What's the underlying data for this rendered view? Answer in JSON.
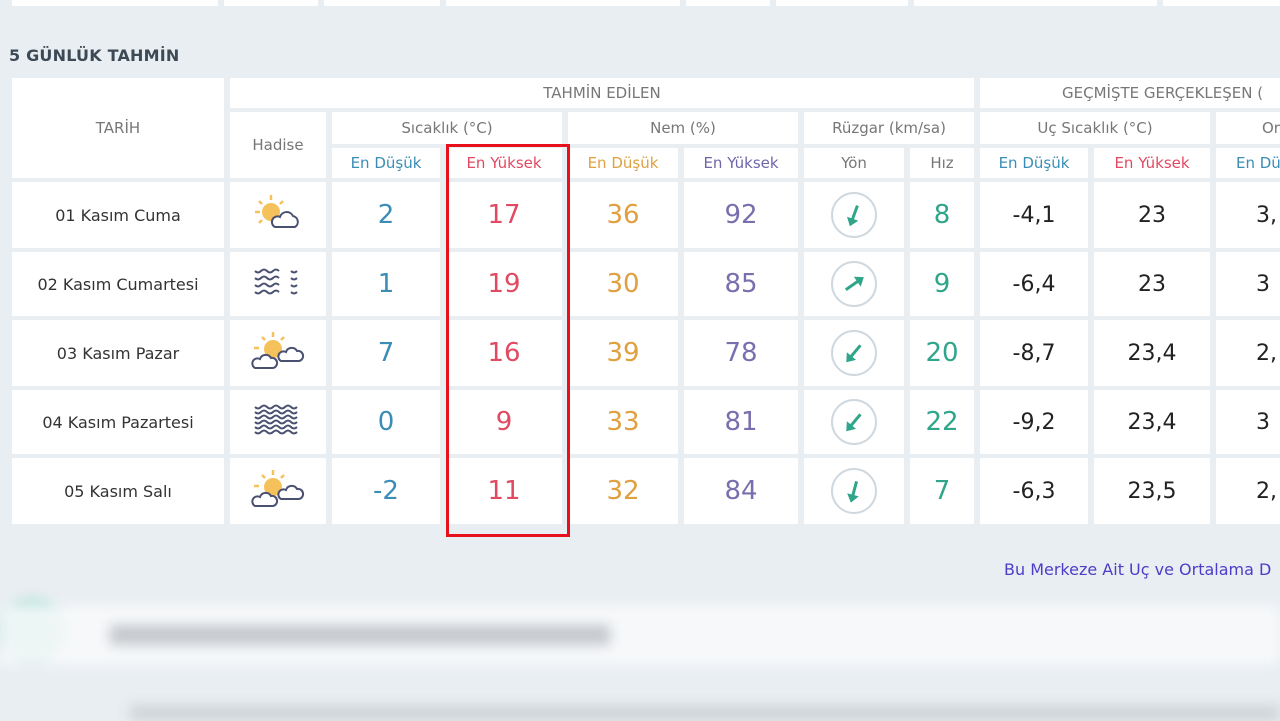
{
  "section_title": "5 GÜNLÜK TAHMİN",
  "headers": {
    "tarih": "TARİH",
    "hadise": "Hadise",
    "tahmin": "TAHMİN EDİLEN",
    "gecmis": "GEÇMİŞTE GERÇEKLEŞEN (",
    "sicaklik": "Sıcaklık (°C)",
    "nem": "Nem (%)",
    "ruzgar": "Rüzgar (km/sa)",
    "uc_sicaklik": "Uç Sıcaklık (°C)",
    "ort": "Orta",
    "en_dusuk": "En Düşük",
    "en_yuksek": "En Yüksek",
    "yon": "Yön",
    "hiz": "Hız",
    "en_du_partial": "En Dü"
  },
  "rows": [
    {
      "date": "01 Kasım Cuma",
      "icon": "sun-cloud-icon",
      "t_min": "2",
      "t_max": "17",
      "h_min": "36",
      "h_max": "92",
      "wind_dir_deg": 200,
      "wind_speed": "8",
      "past_min": "-4,1",
      "past_max": "23",
      "avg_min": "3,"
    },
    {
      "date": "02 Kasım Cumartesi",
      "icon": "fog-wind-icon",
      "t_min": "1",
      "t_max": "19",
      "h_min": "30",
      "h_max": "85",
      "wind_dir_deg": 55,
      "wind_speed": "9",
      "past_min": "-6,4",
      "past_max": "23",
      "avg_min": "3"
    },
    {
      "date": "03 Kasım Pazar",
      "icon": "sun-two-clouds-icon",
      "t_min": "7",
      "t_max": "16",
      "h_min": "39",
      "h_max": "78",
      "wind_dir_deg": 220,
      "wind_speed": "20",
      "past_min": "-8,7",
      "past_max": "23,4",
      "avg_min": "2,"
    },
    {
      "date": "04 Kasım Pazartesi",
      "icon": "fog-icon",
      "t_min": "0",
      "t_max": "9",
      "h_min": "33",
      "h_max": "81",
      "wind_dir_deg": 220,
      "wind_speed": "22",
      "past_min": "-9,2",
      "past_max": "23,4",
      "avg_min": "3"
    },
    {
      "date": "05 Kasım Salı",
      "icon": "sun-two-clouds-icon",
      "t_min": "-2",
      "t_max": "11",
      "h_min": "32",
      "h_max": "84",
      "wind_dir_deg": 195,
      "wind_speed": "7",
      "past_min": "-6,3",
      "past_max": "23,5",
      "avg_min": "2,"
    }
  ],
  "link_text": "Bu Merkeze Ait Uç ve Ortalama D",
  "colors": {
    "highlight": "#e8101a",
    "wind_speed": "#2fa58a",
    "link": "#4a3ec8"
  }
}
